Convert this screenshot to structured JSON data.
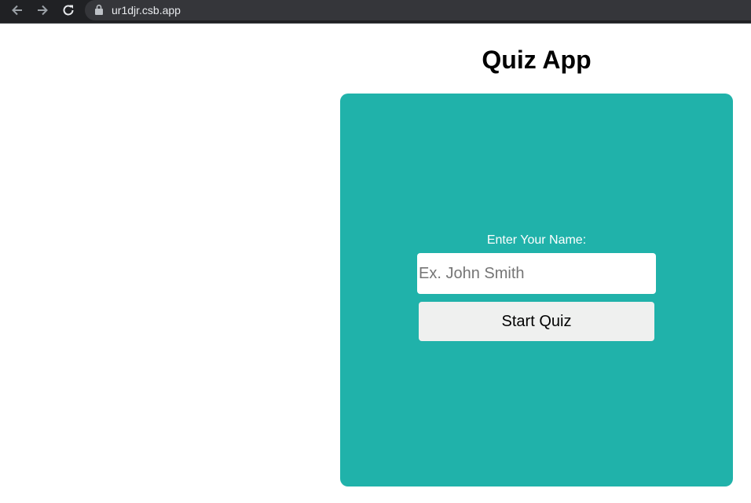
{
  "browser": {
    "url": "ur1djr.csb.app"
  },
  "page": {
    "title": "Quiz App"
  },
  "quiz_form": {
    "name_label": "Enter Your Name:",
    "name_placeholder": "Ex. John Smith",
    "name_value": "",
    "start_button_label": "Start Quiz"
  },
  "colors": {
    "card_background": "#20b2aa",
    "button_background": "#eff0ef",
    "browser_bar": "#202124"
  }
}
